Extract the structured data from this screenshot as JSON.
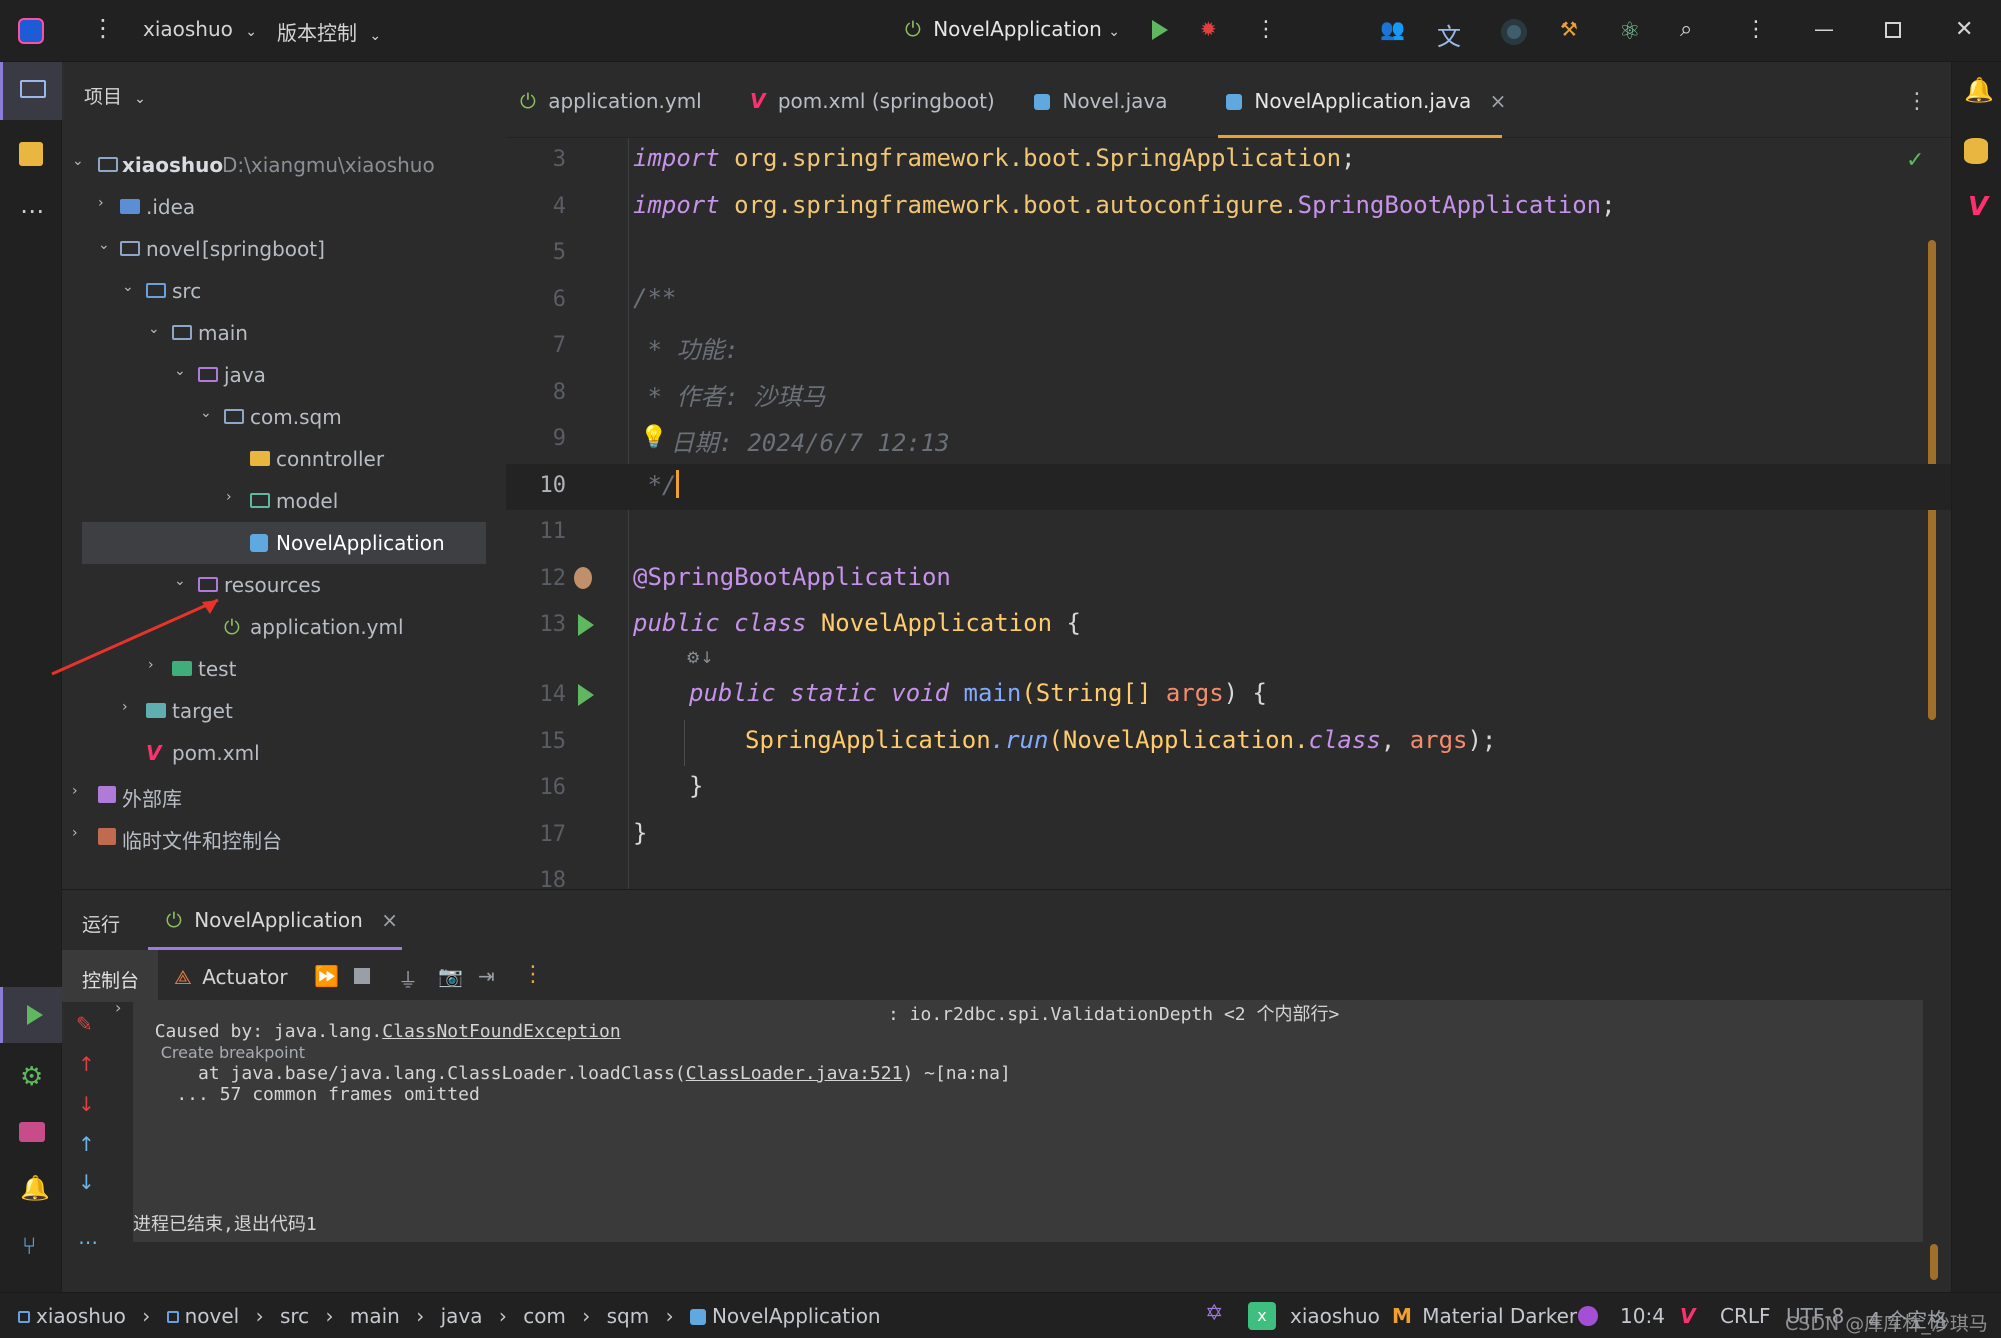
{
  "titlebar": {
    "project": "xiaoshuo",
    "vcs": "版本控制",
    "run_config": "NovelApplication"
  },
  "project_panel": {
    "header": "项目",
    "tree": [
      {
        "label": "xiaoshuo",
        "suffix": "D:\\xiangmu\\xiaoshuo"
      },
      {
        "label": ".idea"
      },
      {
        "label": "novel",
        "suffix": "[springboot]"
      },
      {
        "label": "src"
      },
      {
        "label": "main"
      },
      {
        "label": "java"
      },
      {
        "label": "com.sqm"
      },
      {
        "label": "conntroller"
      },
      {
        "label": "model"
      },
      {
        "label": "NovelApplication"
      },
      {
        "label": "resources"
      },
      {
        "label": "application.yml"
      },
      {
        "label": "test"
      },
      {
        "label": "target"
      },
      {
        "label": "pom.xml"
      },
      {
        "label": "外部库"
      },
      {
        "label": "临时文件和控制台"
      }
    ]
  },
  "tabs": [
    {
      "label": "application.yml"
    },
    {
      "label": "pom.xml (springboot)"
    },
    {
      "label": "Novel.java"
    },
    {
      "label": "NovelApplication.java",
      "close": "×"
    }
  ],
  "editor": {
    "line_numbers": [
      "3",
      "4",
      "5",
      "6",
      "7",
      "8",
      "9",
      "10",
      "11",
      "12",
      "13",
      "14",
      "15",
      "16",
      "17",
      "18"
    ],
    "l3_kw": "import",
    "l3_rest": " org.springframework.boot.",
    "l3_cls": "SpringApplication",
    "l4_kw": "import",
    "l4_rest": " org.springframework.boot.autoconfigure.",
    "l4_cls": "SpringBootApplication",
    "l6": "/**",
    "l7": " * 功能:",
    "l8": " * 作者: 沙琪马",
    "l9": " 日期: 2024/6/7 12:13",
    "l10": " */",
    "l12": "@SpringBootApplication",
    "l13_kw": "public class",
    "l13_cls": " NovelApplication",
    "l13_brace": " {",
    "l14_kw": "public static void",
    "l14_fn": " main",
    "l14_type": "(String[]",
    "l14_arg": " args",
    "l14_end": ") {",
    "l15_cls": "SpringApplication",
    "l15_fn": ".run",
    "l15_p1": "(NovelApplication.",
    "l15_kw": "class",
    "l15_p2": ", ",
    "l15_arg": "args",
    "l15_end": ");",
    "l16": "}",
    "l17": "}"
  },
  "run_panel": {
    "title": "运行",
    "tab": "NovelApplication",
    "tab_close": "×",
    "console_tab": "控制台",
    "actuator_tab": "Actuator",
    "console_lines": {
      "caused_prefix": "Caused by: java.lang.",
      "caused_link": "ClassNotFoundException",
      "create_bp": "Create breakpoint",
      "caused_rest": ": io.r2dbc.spi.ValidationDepth <2 个内部行>",
      "at_prefix": "    at java.base/java.lang.ClassLoader.loadClass(",
      "at_link": "ClassLoader.java:521",
      "at_rest": ") ~[na:na]",
      "omitted": "    ... 57 common frames omitted",
      "exit": "进程已结束,退出代码1"
    }
  },
  "statusbar": {
    "crumbs": [
      "xiaoshuo",
      "novel",
      "src",
      "main",
      "java",
      "com",
      "sqm",
      "NovelApplication"
    ],
    "sep": "›",
    "project": "xiaoshuo",
    "theme": "Material Darker",
    "position": "10:4",
    "line_sep": "CRLF",
    "encoding": "UTF-8",
    "indent": "4 个空格",
    "watermark": "CSDN @库库林_沙琪马"
  },
  "colors": {
    "accent_orange": "#f0a030",
    "run_green": "#5fb85f",
    "error_red": "#e04040",
    "selection": "#3d3f43"
  }
}
